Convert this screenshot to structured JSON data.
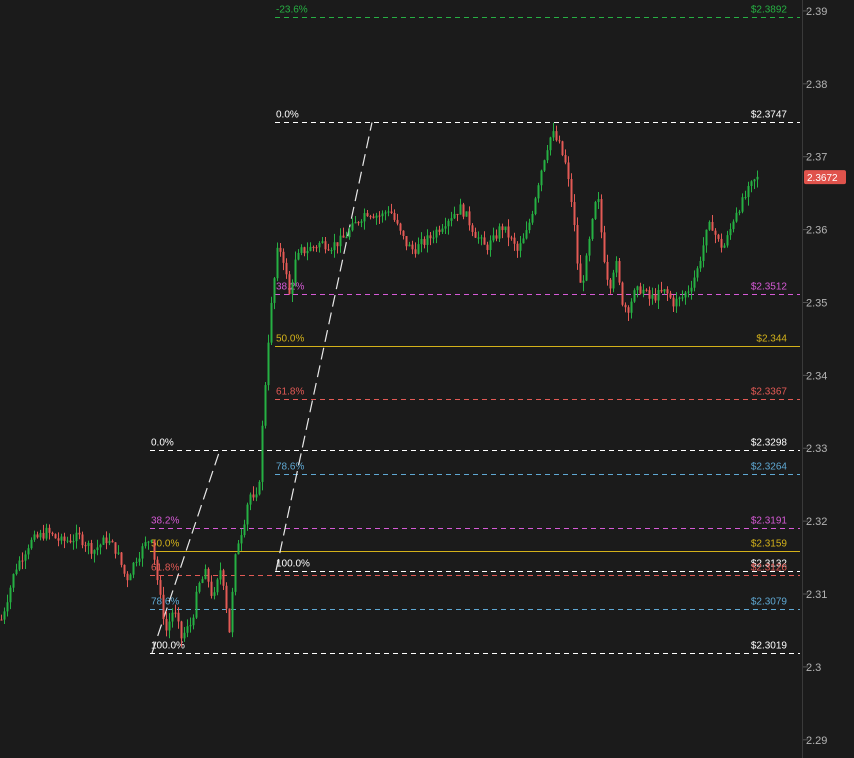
{
  "chart_data": {
    "type": "candlestick",
    "y_axis": {
      "ticks": [
        "2.39",
        "2.38",
        "2.37",
        "2.36",
        "2.35",
        "2.34",
        "2.33",
        "2.32",
        "2.31",
        "2.3",
        "2.29"
      ],
      "ylim": [
        2.2875,
        2.3915
      ]
    },
    "last_price": {
      "label": "2.3672",
      "value": 2.3672,
      "color": "#e0534c"
    },
    "colors": {
      "up": "#26b043",
      "down": "#e35a55",
      "background": "#1b1b1b"
    },
    "fib_sets": [
      {
        "name": "fib-upper",
        "levels": [
          {
            "pct": "-23.6%",
            "price": "$2.3892",
            "value": 2.3892,
            "color": "#26b043",
            "style": "dashed"
          },
          {
            "pct": "0.0%",
            "price": "$2.3747",
            "value": 2.3747,
            "color": "#ffffff",
            "style": "dashed"
          },
          {
            "pct": "38.2%",
            "price": "$2.3512",
            "value": 2.3512,
            "color": "#d65ad6",
            "style": "dashed"
          },
          {
            "pct": "50.0%",
            "price": "$2.344",
            "value": 2.344,
            "color": "#d4b21a",
            "style": "solid"
          },
          {
            "pct": "61.8%",
            "price": "$2.3367",
            "value": 2.3367,
            "color": "#e35a55",
            "style": "dashed"
          },
          {
            "pct": "78.6%",
            "price": "$2.3264",
            "value": 2.3264,
            "color": "#5fa8d3",
            "style": "dashed"
          },
          {
            "pct": "100.0%",
            "price": "$2.3132",
            "value": 2.3132,
            "color": "#ffffff",
            "style": "dashed"
          }
        ]
      },
      {
        "name": "fib-lower",
        "levels": [
          {
            "pct": "0.0%",
            "price": "$2.3298",
            "value": 2.3298,
            "color": "#ffffff",
            "style": "dashed"
          },
          {
            "pct": "38.2%",
            "price": "$2.3191",
            "value": 2.3191,
            "color": "#d65ad6",
            "style": "dashed"
          },
          {
            "pct": "50.0%",
            "price": "$2.3159",
            "value": 2.3159,
            "color": "#d4b21a",
            "style": "solid"
          },
          {
            "pct": "61.8%",
            "price": "$2.3126",
            "value": 2.3126,
            "color": "#e35a55",
            "style": "dashed"
          },
          {
            "pct": "78.6%",
            "price": "$2.3079",
            "value": 2.3079,
            "color": "#5fa8d3",
            "style": "dashed"
          },
          {
            "pct": "100.0%",
            "price": "$2.3019",
            "value": 2.3019,
            "color": "#ffffff",
            "style": "dashed"
          }
        ]
      }
    ],
    "trend_lines": [
      {
        "from": [
          152,
          2.3019
        ],
        "to": [
          220,
          2.3298
        ]
      },
      {
        "from": [
          276,
          2.3132
        ],
        "to": [
          372,
          2.3747
        ]
      }
    ],
    "series": [
      {
        "name": "",
        "points": [
          [
            0,
            2.3065
          ],
          [
            14,
            2.3135
          ],
          [
            28,
            2.317
          ],
          [
            45,
            2.3185
          ],
          [
            60,
            2.3172
          ],
          [
            78,
            2.3178
          ],
          [
            92,
            2.316
          ],
          [
            105,
            2.3175
          ],
          [
            115,
            2.316
          ],
          [
            125,
            2.312
          ],
          [
            135,
            2.315
          ],
          [
            150,
            2.318
          ],
          [
            158,
            2.31
          ],
          [
            165,
            2.305
          ],
          [
            172,
            2.308
          ],
          [
            180,
            2.304
          ],
          [
            190,
            2.306
          ],
          [
            197,
            2.311
          ],
          [
            205,
            2.313
          ],
          [
            212,
            2.309
          ],
          [
            220,
            2.314
          ],
          [
            228,
            2.305
          ],
          [
            235,
            2.3165
          ],
          [
            242,
            2.3195
          ],
          [
            248,
            2.324
          ],
          [
            254,
            2.322
          ],
          [
            258,
            2.326
          ],
          [
            262,
            2.335
          ],
          [
            268,
            2.347
          ],
          [
            272,
            2.352
          ],
          [
            277,
            2.358
          ],
          [
            282,
            2.356
          ],
          [
            288,
            2.351
          ],
          [
            294,
            2.3555
          ],
          [
            300,
            2.357
          ],
          [
            310,
            2.3575
          ],
          [
            320,
            2.3582
          ],
          [
            330,
            2.3578
          ],
          [
            340,
            2.3585
          ],
          [
            350,
            2.36
          ],
          [
            358,
            2.3615
          ],
          [
            365,
            2.3625
          ],
          [
            372,
            2.3622
          ],
          [
            380,
            2.3618
          ],
          [
            388,
            2.363
          ],
          [
            394,
            2.361
          ],
          [
            400,
            2.3592
          ],
          [
            406,
            2.3578
          ],
          [
            412,
            2.3572
          ],
          [
            420,
            2.358
          ],
          [
            428,
            2.3588
          ],
          [
            436,
            2.36
          ],
          [
            444,
            2.3612
          ],
          [
            452,
            2.3622
          ],
          [
            460,
            2.363
          ],
          [
            468,
            2.361
          ],
          [
            476,
            2.359
          ],
          [
            484,
            2.3575
          ],
          [
            492,
            2.3585
          ],
          [
            500,
            2.3605
          ],
          [
            508,
            2.359
          ],
          [
            516,
            2.357
          ],
          [
            524,
            2.359
          ],
          [
            530,
            2.362
          ],
          [
            536,
            2.366
          ],
          [
            542,
            2.3695
          ],
          [
            548,
            2.3725
          ],
          [
            552,
            2.373
          ],
          [
            558,
            2.3715
          ],
          [
            564,
            2.369
          ],
          [
            570,
            2.364
          ],
          [
            574,
            2.359
          ],
          [
            578,
            2.352
          ],
          [
            583,
            2.354
          ],
          [
            590,
            2.36
          ],
          [
            596,
            2.365
          ],
          [
            602,
            2.357
          ],
          [
            608,
            2.352
          ],
          [
            614,
            2.356
          ],
          [
            620,
            2.3505
          ],
          [
            626,
            2.349
          ],
          [
            632,
            2.351
          ],
          [
            640,
            2.352
          ],
          [
            648,
            2.3505
          ],
          [
            656,
            2.351
          ],
          [
            664,
            2.3515
          ],
          [
            672,
            2.35
          ],
          [
            680,
            2.3505
          ],
          [
            688,
            2.352
          ],
          [
            696,
            2.3545
          ],
          [
            704,
            2.359
          ],
          [
            710,
            2.361
          ],
          [
            716,
            2.3585
          ],
          [
            722,
            2.3575
          ],
          [
            728,
            2.3595
          ],
          [
            734,
            2.3625
          ],
          [
            740,
            2.3635
          ],
          [
            746,
            2.365
          ],
          [
            752,
            2.3665
          ],
          [
            758,
            2.3672
          ]
        ]
      }
    ]
  }
}
